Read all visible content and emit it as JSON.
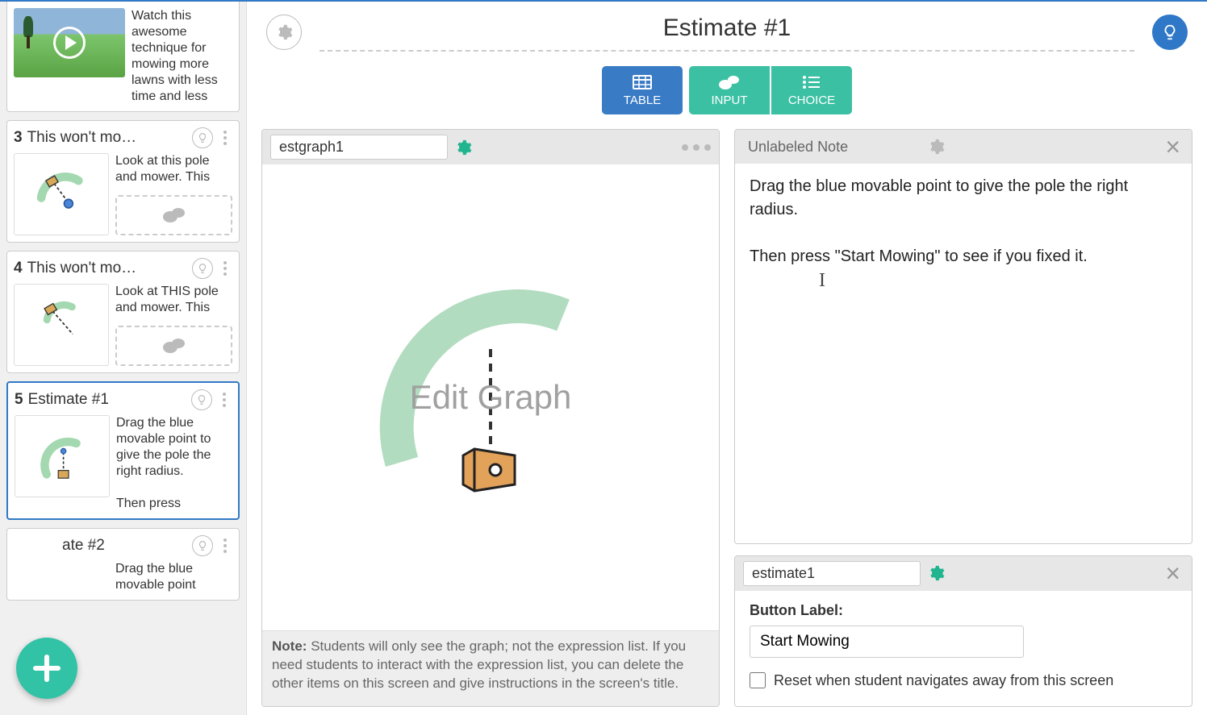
{
  "colors": {
    "accent_blue": "#3179c6",
    "accent_teal": "#32c3a6",
    "teal_dark": "#21b58f"
  },
  "sidebar": {
    "items": [
      {
        "num": "",
        "title": "",
        "desc": "Watch this awesome technique for mowing more lawns with less time and less"
      },
      {
        "num": "3",
        "title": "This won't mo…",
        "desc": "Look at this pole and mower. This"
      },
      {
        "num": "4",
        "title": "This won't mo…",
        "desc": "Look at THIS pole and mower. This"
      },
      {
        "num": "5",
        "title": "Estimate #1",
        "desc": "Drag the blue movable point to give the pole the right radius.\n\nThen press"
      },
      {
        "num": "",
        "title": "ate #2",
        "desc": "Drag the blue movable point"
      }
    ]
  },
  "page": {
    "title": "Estimate #1"
  },
  "tabs": {
    "table": "TABLE",
    "input": "INPUT",
    "choice": "CHOICE"
  },
  "graph_panel": {
    "name": "estgraph1",
    "overlay": "Edit Graph",
    "note_bold": "Note:",
    "note_body": "Students will only see the graph; not the expression list. If you need students to interact with the expression list, you can delete the other items on this screen and give instructions in the screen's title."
  },
  "note_panel": {
    "name": "Unlabeled Note",
    "para1": "Drag the blue movable point to give the pole the right radius.",
    "para2": "Then press \"Start Mowing\" to see if you fixed it."
  },
  "button_panel": {
    "name": "estimate1",
    "label_title": "Button Label:",
    "label_value": "Start Mowing",
    "checkbox_label": "Reset when student navigates away from this screen"
  }
}
